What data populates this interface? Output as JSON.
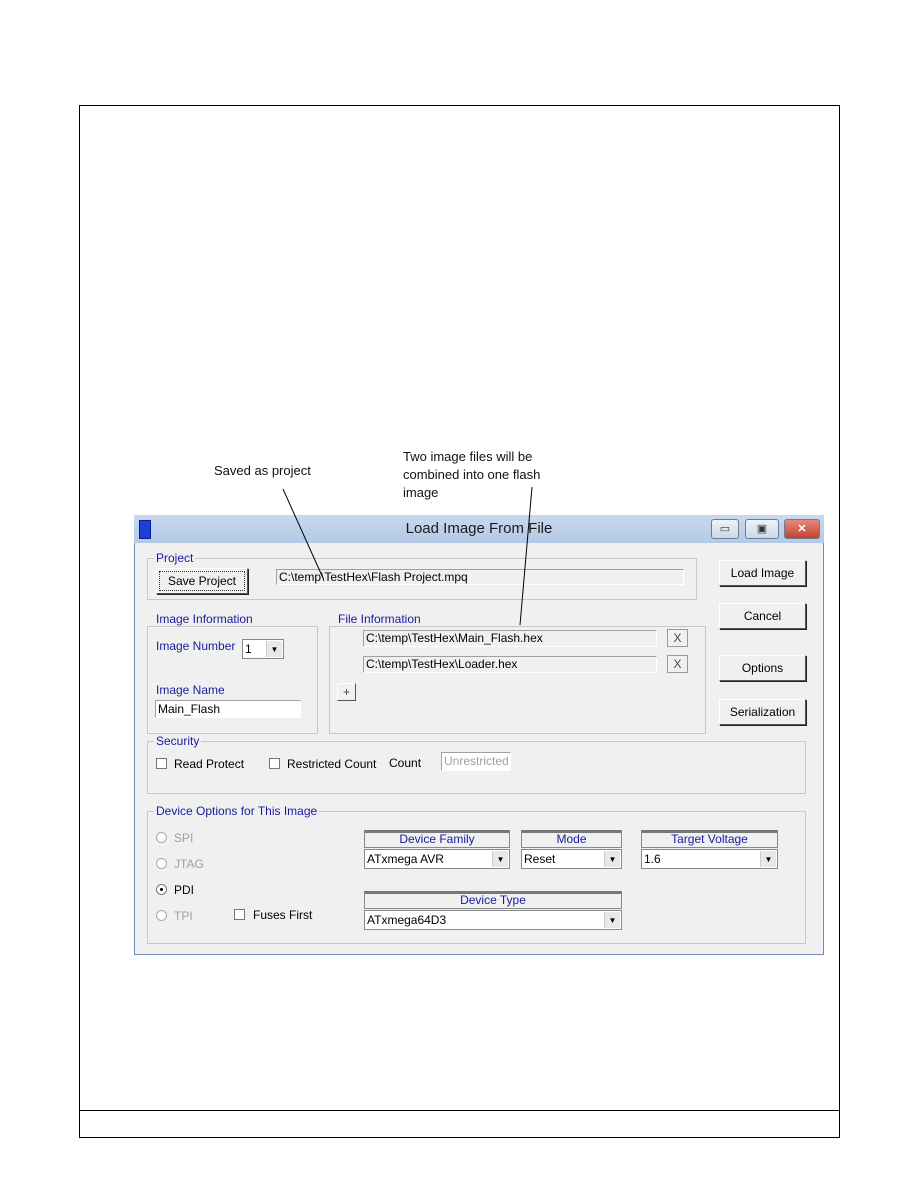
{
  "annotations": {
    "saved_note": "Saved as project",
    "combined_note_lines": [
      "Two image files will be",
      "combined into one flash",
      "image"
    ]
  },
  "window": {
    "title": "Load Image From File",
    "controls": {
      "minimize": "▭",
      "maximize": "▣",
      "close": "✕"
    }
  },
  "project": {
    "group_label": "Project",
    "save_button": "Save Project",
    "path": "C:\\temp\\TestHex\\Flash Project.mpq"
  },
  "side_buttons": {
    "load_image": "Load Image",
    "cancel": "Cancel",
    "options": "Options",
    "serialization": "Serialization"
  },
  "image_info": {
    "group_label": "Image Information",
    "number_label": "Image Number",
    "number_value": "1",
    "name_label": "Image Name",
    "name_value": "Main_Flash"
  },
  "file_info": {
    "group_label": "File Information",
    "files": [
      "C:\\temp\\TestHex\\Main_Flash.hex",
      "C:\\temp\\TestHex\\Loader.hex"
    ],
    "remove_label": "X",
    "add_label": "+"
  },
  "security": {
    "group_label": "Security",
    "read_protect": "Read Protect",
    "restricted_count": "Restricted Count",
    "count_label": "Count",
    "count_value": "Unrestricted"
  },
  "device_options": {
    "group_label": "Device Options for This Image",
    "interfaces": [
      {
        "label": "SPI",
        "enabled": false,
        "selected": false
      },
      {
        "label": "JTAG",
        "enabled": false,
        "selected": false
      },
      {
        "label": "PDI",
        "enabled": true,
        "selected": true
      },
      {
        "label": "TPI",
        "enabled": false,
        "selected": false
      }
    ],
    "fuses_first": "Fuses First",
    "device_family_label": "Device Family",
    "device_family": "ATxmega AVR",
    "mode_label": "Mode",
    "mode": "Reset",
    "target_voltage_label": "Target Voltage",
    "target_voltage": "1.6",
    "device_type_label": "Device Type",
    "device_type": "ATxmega64D3"
  }
}
